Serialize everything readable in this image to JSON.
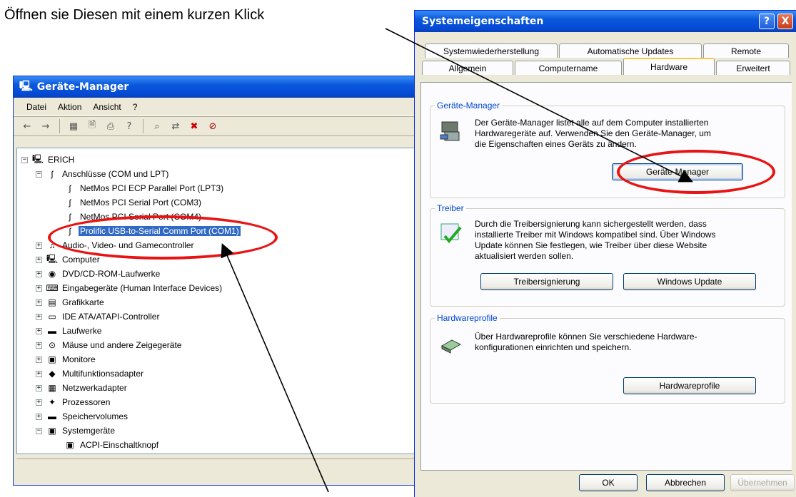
{
  "annotation": {
    "top_text": "Öffnen sie Diesen mit einem kurzen Klick"
  },
  "device_manager": {
    "title": "Geräte-Manager",
    "menu": [
      "Datei",
      "Aktion",
      "Ansicht",
      "?"
    ],
    "toolbar_icons": [
      "back-arrow-icon",
      "forward-arrow-icon",
      "tree-view-icon",
      "properties-icon",
      "print-icon",
      "help-icon",
      "scan-hardware-icon",
      "update-driver-icon",
      "uninstall-icon",
      "disable-icon"
    ],
    "tree": {
      "root": "ERICH",
      "ports_category": "Anschlüsse (COM und LPT)",
      "ports": [
        "NetMos PCI ECP Parallel Port (LPT3)",
        "NetMos PCI Serial Port (COM3)",
        "NetMos PCI Serial Port (COM4)",
        "Prolific USB-to-Serial Comm Port (COM1)"
      ],
      "categories": [
        "Audio-, Video- und Gamecontroller",
        "Computer",
        "DVD/CD-ROM-Laufwerke",
        "Eingabegeräte (Human Interface Devices)",
        "Grafikkarte",
        "IDE ATA/ATAPI-Controller",
        "Laufwerke",
        "Mäuse und andere Zeigegeräte",
        "Monitore",
        "Multifunktionsadapter",
        "Netzwerkadapter",
        "Prozessoren",
        "Speichervolumes",
        "Systemgeräte"
      ],
      "system_child": "ACPI-Einschaltknopf"
    }
  },
  "system_properties": {
    "title": "Systemeigenschaften",
    "help_button": "?",
    "close_button": "X",
    "tabs_row1": [
      "Systemwiederherstellung",
      "Automatische Updates",
      "Remote"
    ],
    "tabs_row2": [
      "Allgemein",
      "Computername",
      "Hardware",
      "Erweitert"
    ],
    "active_tab": "Hardware",
    "device_manager_group": {
      "title": "Geräte-Manager",
      "text": "Der Geräte-Manager listet alle auf dem Computer installierten\nHardwaregeräte auf. Verwenden Sie den Geräte-Manager, um\ndie Eigenschaften eines Geräts zu ändern.",
      "button": "Geräte-Manager"
    },
    "driver_group": {
      "title": "Treiber",
      "text": "Durch die Treibersignierung kann sichergestellt werden, dass\ninstallierte Treiber mit Windows kompatibel sind. Über Windows\nUpdate können Sie festlegen, wie Treiber über diese Website\naktualisiert werden sollen.",
      "button_signing": "Treibersignierung",
      "button_update": "Windows Update"
    },
    "profiles_group": {
      "title": "Hardwareprofile",
      "text": "Über Hardwareprofile können Sie verschiedene Hardware-\nkonfigurationen einrichten und speichern.",
      "button": "Hardwareprofile"
    },
    "footer": {
      "ok": "OK",
      "cancel": "Abbrechen",
      "apply": "Übernehmen"
    }
  }
}
